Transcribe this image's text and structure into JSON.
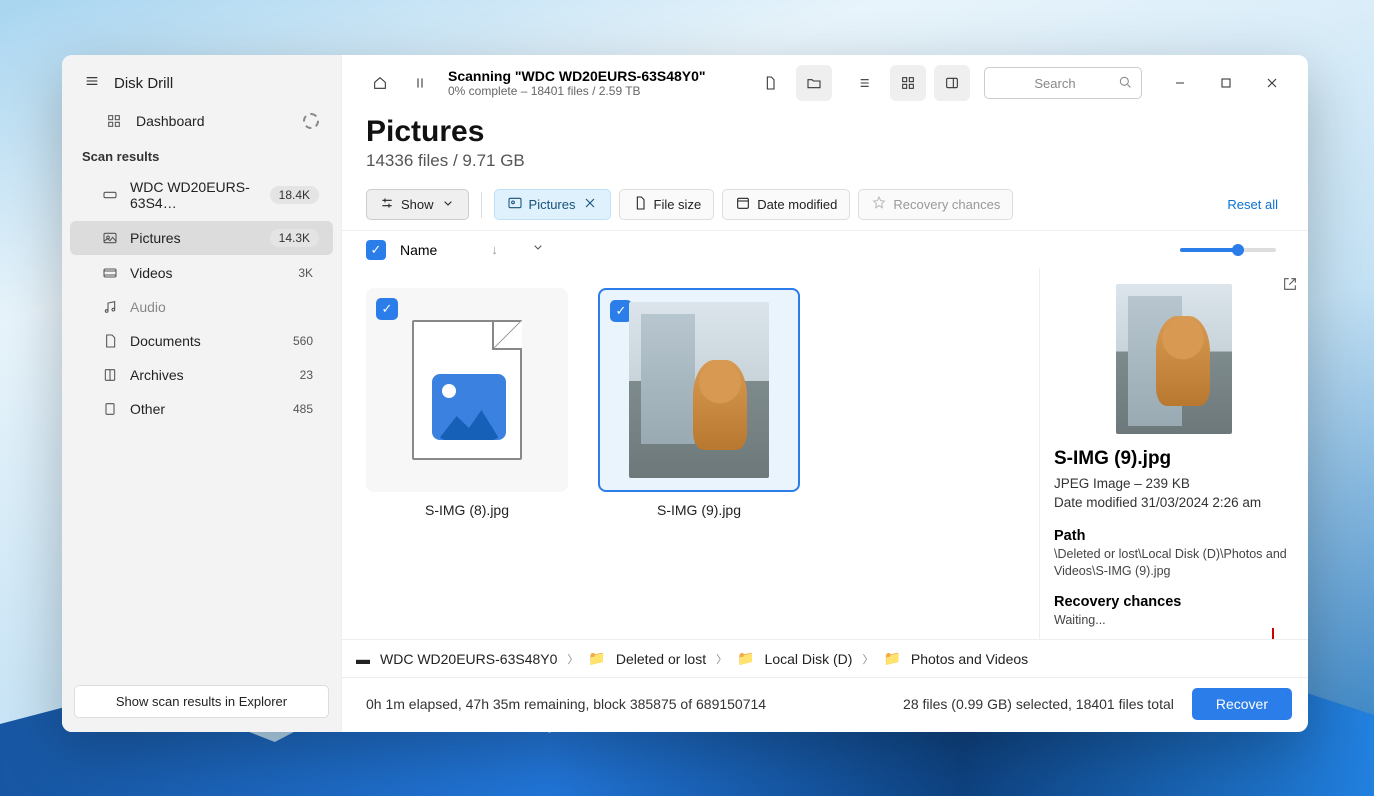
{
  "app": {
    "title": "Disk Drill"
  },
  "sidebar": {
    "dashboard": "Dashboard",
    "section": "Scan results",
    "items": [
      {
        "label": "WDC WD20EURS-63S4…",
        "badge": "18.4K"
      },
      {
        "label": "Pictures",
        "badge": "14.3K"
      },
      {
        "label": "Videos",
        "badge": "3K"
      },
      {
        "label": "Audio",
        "badge": ""
      },
      {
        "label": "Documents",
        "badge": "560"
      },
      {
        "label": "Archives",
        "badge": "23"
      },
      {
        "label": "Other",
        "badge": "485"
      }
    ],
    "footer_btn": "Show scan results in Explorer"
  },
  "scan": {
    "title": "Scanning \"WDC WD20EURS-63S48Y0\"",
    "subtitle": "0% complete – 18401 files / 2.59 TB"
  },
  "search": {
    "placeholder": "Search"
  },
  "page": {
    "title": "Pictures",
    "subtitle": "14336 files / 9.71 GB"
  },
  "filters": {
    "show": "Show",
    "pictures": "Pictures",
    "filesize": "File size",
    "datemod": "Date modified",
    "recovery": "Recovery chances",
    "reset": "Reset all"
  },
  "cols": {
    "name": "Name"
  },
  "files": [
    {
      "name": "S-IMG (8).jpg"
    },
    {
      "name": "S-IMG (9).jpg"
    }
  ],
  "details": {
    "name": "S-IMG (9).jpg",
    "type": "JPEG Image – 239 KB",
    "date": "Date modified 31/03/2024 2:26 am",
    "path_label": "Path",
    "path": "\\Deleted or lost\\Local Disk (D)\\Photos and Videos\\S-IMG (9).jpg",
    "rc_label": "Recovery chances",
    "rc_value": "Waiting..."
  },
  "breadcrumb": {
    "root": "WDC WD20EURS-63S48Y0",
    "p1": "Deleted or lost",
    "p2": "Local Disk (D)",
    "p3": "Photos and Videos"
  },
  "status": {
    "left": "0h 1m elapsed, 47h 35m remaining, block 385875 of 689150714",
    "right": "28 files (0.99 GB) selected, 18401 files total",
    "recover": "Recover"
  }
}
